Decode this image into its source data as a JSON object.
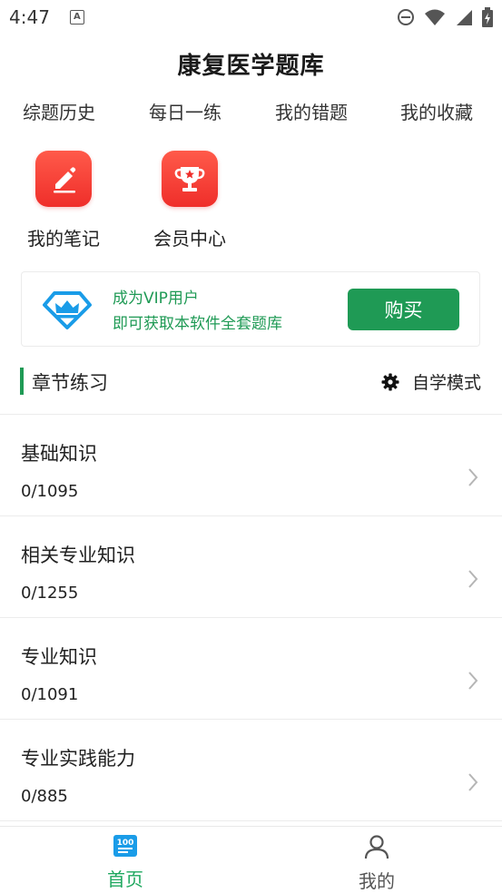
{
  "status_bar": {
    "time": "4:47",
    "notification_icon": "a-icon",
    "icons": [
      "do-not-disturb-icon",
      "wifi-icon",
      "signal-icon",
      "battery-icon"
    ]
  },
  "app": {
    "title": "康复医学题库"
  },
  "cut_row": {
    "items": [
      "综题历史",
      "每日一练",
      "我的错题",
      "我的收藏"
    ]
  },
  "grid": {
    "items": [
      {
        "label": "我的笔记",
        "icon": "pencil-note-icon"
      },
      {
        "label": "会员中心",
        "icon": "trophy-icon"
      }
    ]
  },
  "vip": {
    "line1": "成为VIP用户",
    "line2": "即可获取本软件全套题库",
    "buy_label": "购买",
    "icon": "vip-diamond-icon"
  },
  "section": {
    "title": "章节练习",
    "mode_label": "自学模式",
    "mode_icon": "gear-icon"
  },
  "chapters": [
    {
      "name": "基础知识",
      "progress": "0/1095"
    },
    {
      "name": "相关专业知识",
      "progress": "0/1255"
    },
    {
      "name": "专业知识",
      "progress": "0/1091"
    },
    {
      "name": "专业实践能力",
      "progress": "0/885"
    }
  ],
  "nav": {
    "home": {
      "label": "首页",
      "icon": "home-100-icon"
    },
    "mine": {
      "label": "我的",
      "icon": "person-icon"
    }
  },
  "colors": {
    "accent": "#1f9a55",
    "icon_red": "#ef2e2a",
    "vip_blue": "#1a9ce8",
    "nav_home": "#1fa85f",
    "nav_inactive": "#555555"
  }
}
